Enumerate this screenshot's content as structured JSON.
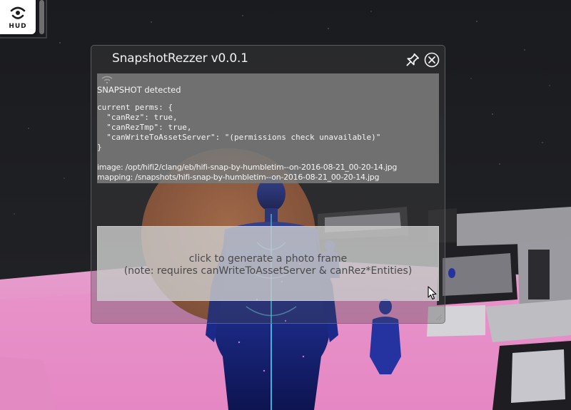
{
  "hud": {
    "label": "HUD",
    "icon": "hud-icon"
  },
  "window": {
    "title": "SnapshotRezzer v0.0.1",
    "pin_icon": "pin-icon",
    "close_icon": "close-icon"
  },
  "info": {
    "detected": "SNAPSHOT detected",
    "perms_block": "current perms: {\n  \"canRez\": true,\n  \"canRezTmp\": true,\n  \"canWriteToAssetServer\": \"(permissions check unavailable)\"\n}",
    "image_path": "image: /opt/hifi2/clang/eb/hifi-snap-by-humbletim--on-2016-08-21_00-20-14.jpg",
    "mapping_path": "mapping: /snapshots/hifi-snap-by-humbletim--on-2016-08-21_00-20-14.jpg"
  },
  "generate_button": {
    "line1": "click to generate a photo frame",
    "line2": "(note: requires canWriteToAssetServer & canRez*Entities)"
  },
  "colors": {
    "sky": "#16171b",
    "floor_pink": "#e88fc8",
    "sun_orange": "#b8683c",
    "panel_gray": "#7a7a7a",
    "button_gray": "#cecece"
  }
}
